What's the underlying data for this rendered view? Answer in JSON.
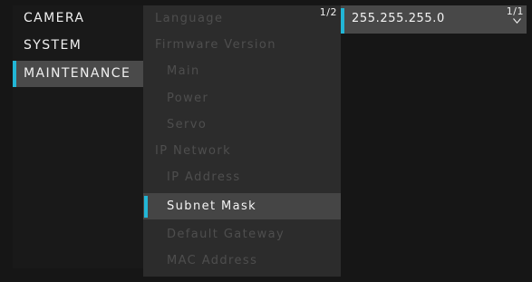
{
  "main_menu": {
    "items": [
      {
        "label": "CAMERA",
        "selected": false
      },
      {
        "label": "SYSTEM",
        "selected": false
      },
      {
        "label": "MAINTENANCE",
        "selected": true
      }
    ]
  },
  "sub_menu": {
    "page_indicator": "1/2",
    "items": [
      {
        "label": "Language",
        "indent": false,
        "selected": false
      },
      {
        "label": "Firmware Version",
        "indent": false,
        "selected": false
      },
      {
        "label": "Main",
        "indent": true,
        "selected": false
      },
      {
        "label": "Power",
        "indent": true,
        "selected": false
      },
      {
        "label": "Servo",
        "indent": true,
        "selected": false
      },
      {
        "label": "IP Network",
        "indent": false,
        "selected": false
      },
      {
        "label": "IP Address",
        "indent": true,
        "selected": false
      },
      {
        "label": "Subnet Mask",
        "indent": true,
        "selected": true
      },
      {
        "label": "Default Gateway",
        "indent": true,
        "selected": false
      },
      {
        "label": "MAC Address",
        "indent": true,
        "selected": false
      }
    ]
  },
  "value_panel": {
    "value": "255.255.255.0",
    "page_indicator": "1/1",
    "more_icon": "chevron-down-icon"
  },
  "colors": {
    "accent": "#22b6d6",
    "selected_background": "#454545",
    "dimmed_text": "#4e4e4e",
    "text": "#f0f0f0"
  }
}
